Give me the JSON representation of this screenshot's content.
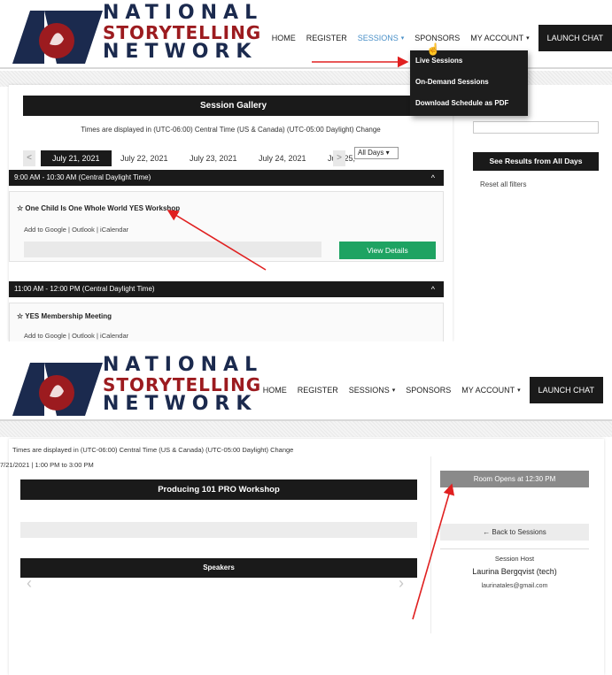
{
  "brand": {
    "line1": "NATIONAL",
    "line2": "STORYTELLING",
    "line3": "NETWORK",
    "blue": "#1b2a4e",
    "red": "#9c1b1f"
  },
  "nav": {
    "home": "HOME",
    "register": "REGISTER",
    "sessions": "SESSIONS",
    "sponsors": "SPONSORS",
    "account": "MY ACCOUNT",
    "chat": "LAUNCH CHAT",
    "caret": "▾"
  },
  "dropdown": {
    "live": "Live Sessions",
    "on_demand": "On-Demand Sessions",
    "pdf": "Download Schedule as PDF"
  },
  "gallery": {
    "title": "Session Gallery",
    "tz_note": "Times are displayed in (UTC-06:00) Central Time (US & Canada) (UTC-05:00 Daylight) Change",
    "dates": [
      "July 21, 2021",
      "July 22, 2021",
      "July 23, 2021",
      "July 24, 2021",
      "July 25,"
    ],
    "days_select": "All Days",
    "prev": "<",
    "next": ">",
    "slots": [
      {
        "time": "9:00 AM - 10:30 AM (Central Daylight Time)",
        "session": "One Child Is One Whole World YES Workshop"
      },
      {
        "time": "11:00 AM - 12:00 PM (Central Daylight Time)",
        "session": "YES Membership Meeting"
      }
    ],
    "calendar_links": "Add to Google | Outlook | iCalendar",
    "view_details": "View Details",
    "star": "☆",
    "chevron": "^"
  },
  "filters": {
    "see_results": "See Results from All Days",
    "reset": "Reset all filters"
  },
  "detail": {
    "tz_note": "Times are displayed in (UTC-06:00) Central Time (US & Canada) (UTC-05:00 Daylight) Change",
    "date_time": "7/21/2021 | 1:00 PM to 3:00 PM",
    "title": "Producing 101 PRO Workshop",
    "speakers": "Speakers",
    "room_opens": "Room Opens at 12:30 PM",
    "back": "← Back to Sessions",
    "host_label": "Session Host",
    "host_name": "Laurina Bergqvist (tech)",
    "host_email": "laurinatales@gmail.com",
    "prev": "‹",
    "next": "›"
  },
  "colors": {
    "accent_green": "#1ea362",
    "annotation_red": "#e02020",
    "active_nav": "#4a90c8"
  }
}
